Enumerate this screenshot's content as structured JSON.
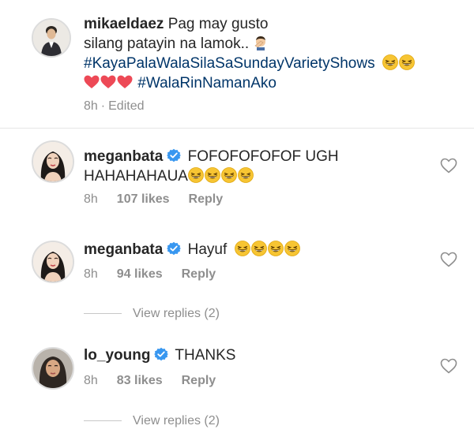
{
  "caption": {
    "username": "mikaeldaez",
    "line1": "Pag may gusto",
    "line2": "silang patayin na lamok..",
    "hashtag1": "#KayaPalaWalaSilaSaSundayVarietyShows",
    "hashtag2": "#WalaRinNamanAko",
    "time": "8h",
    "edited": "Edited",
    "sep": "·",
    "emoji_line2": "facepalm-emoji",
    "emoji_after_hashtag1": [
      "laughing-emoji",
      "laughing-emoji"
    ],
    "emoji_line4": [
      "red-heart",
      "red-heart",
      "red-heart"
    ]
  },
  "comments": [
    {
      "username": "meganbata",
      "verified": true,
      "text_line1": "FOFOFOFOFOF UGH",
      "text_line2": "HAHAHAHAUA",
      "emoji": [
        "laughing-emoji",
        "laughing-emoji",
        "laughing-emoji",
        "laughing-emoji"
      ],
      "time": "8h",
      "likes": "107 likes",
      "reply_label": "Reply"
    },
    {
      "username": "meganbata",
      "verified": true,
      "text_line1": "Hayuf",
      "emoji": [
        "laughing-emoji",
        "laughing-emoji",
        "laughing-emoji",
        "laughing-emoji"
      ],
      "time": "8h",
      "likes": "94 likes",
      "reply_label": "Reply",
      "view_replies": "View replies (2)"
    },
    {
      "username": "lo_young",
      "verified": true,
      "text_line1": "THANKS",
      "time": "8h",
      "likes": "83 likes",
      "reply_label": "Reply",
      "view_replies": "View replies (2)"
    }
  ],
  "colors": {
    "hashtag": "#003569",
    "verified": "#3897f0",
    "meta": "#8e8e8e",
    "heart_red": "#ed4956"
  }
}
